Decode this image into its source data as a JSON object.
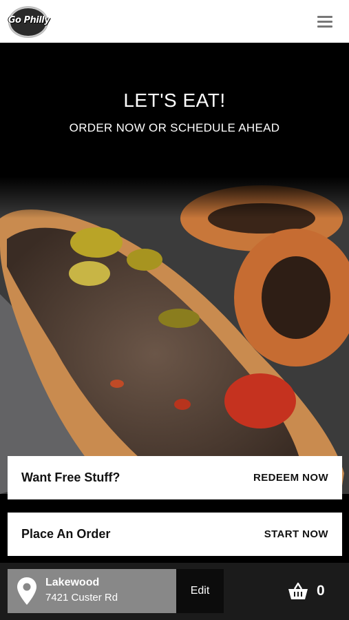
{
  "header": {
    "logo_text": "Go Philly",
    "menu_icon": "hamburger-menu-icon"
  },
  "hero": {
    "title": "LET'S EAT!",
    "subtitle": "ORDER NOW OR SCHEDULE AHEAD"
  },
  "actions": {
    "rewards": {
      "label": "Want Free Stuff?",
      "action": "REDEEM NOW"
    },
    "order": {
      "label": "Place An Order",
      "action": "START NOW"
    }
  },
  "bottom_bar": {
    "location_name": "Lakewood",
    "location_address": "7421 Custer Rd",
    "edit_label": "Edit",
    "cart_count": "0",
    "location_icon": "map-pin-icon",
    "cart_icon": "basket-icon"
  },
  "colors": {
    "header_bg": "#ffffff",
    "hero_bg": "#000000",
    "card_bg": "#ffffff",
    "location_bg": "#888888",
    "bottom_bar_bg": "#1b1b1b"
  }
}
